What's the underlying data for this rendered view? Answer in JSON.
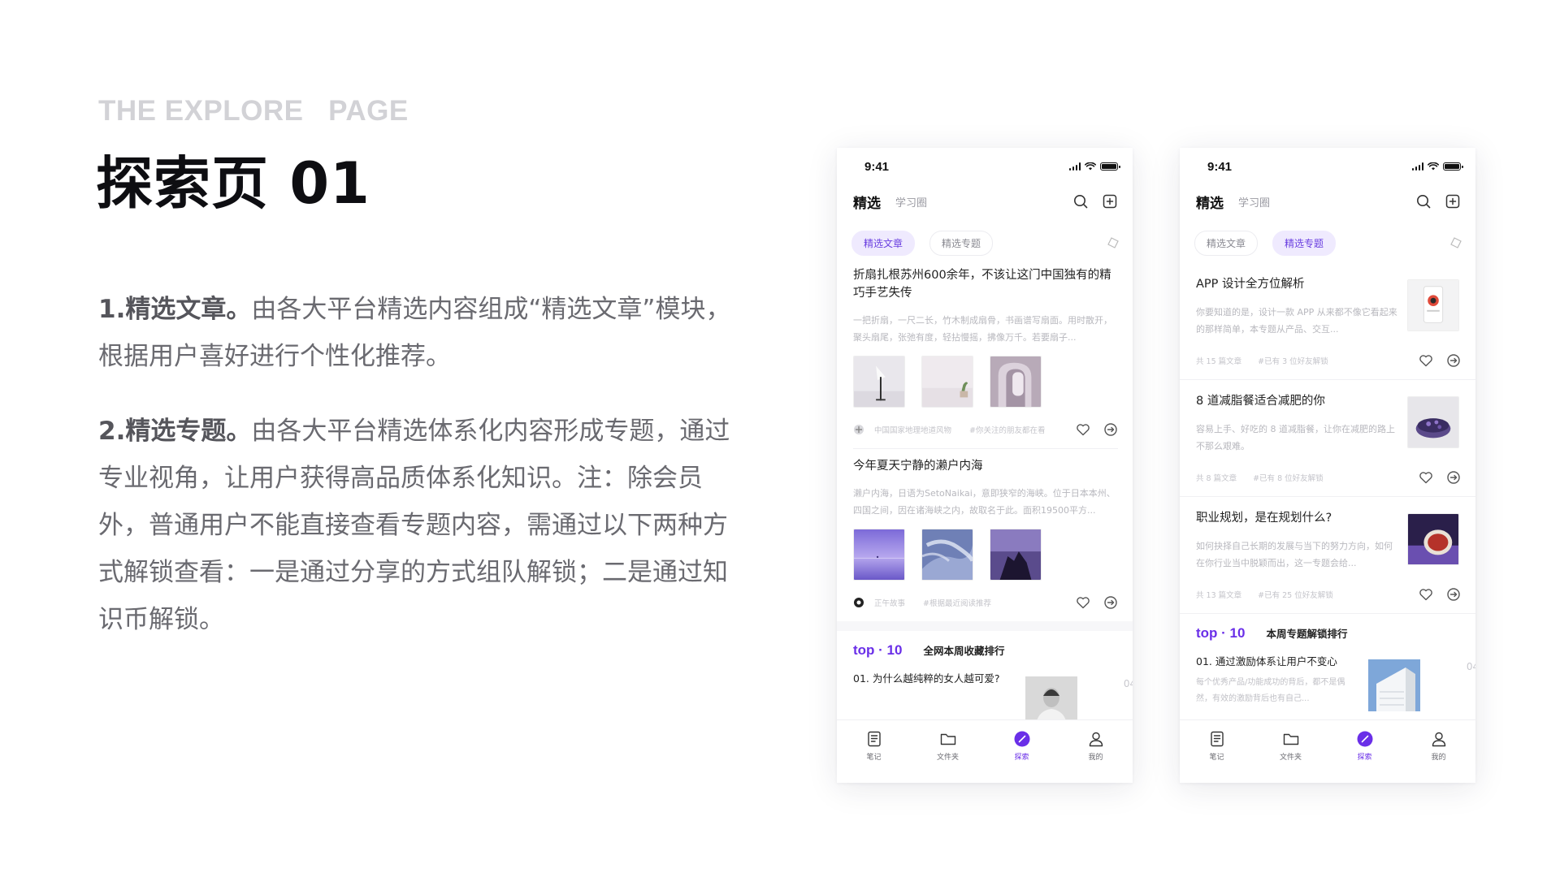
{
  "header": {
    "eyebrow": "THE EXPLORE   PAGE",
    "title": "探索页 01"
  },
  "description": {
    "p1_strong": "1.精选文章。",
    "p1_text": "由各大平台精选内容组成“精选文章”模块，根据用户喜好进行个性化推荐。",
    "p2_strong": "2.精选专题。",
    "p2_text": "由各大平台精选体系化内容形成专题，通过专业视角，让用户获得高品质体系化知识。注：除会员外，普通用户不能直接查看专题内容，需通过以下两种方式解锁查看：一是通过分享的方式组队解锁；二是通过知识币解锁。"
  },
  "colors": {
    "accent": "#6a2fe8",
    "chip_bg": "#efeafe"
  },
  "phoneA": {
    "time": "9:41",
    "tab_main": "精选",
    "tab_sub": "学习圈",
    "chip1": "精选文章",
    "chip2": "精选专题",
    "active_chip": "精选文章",
    "articles": [
      {
        "title": "折扇扎根苏州600余年，不该让这门中国独有的精巧手艺失传",
        "desc": "一把折扇，一尺二长，竹木制成扇骨，书画谱写扇面。用时散开，聚头扇尾，张弛有度，轻拈慢摇，拂像万千。若要扇子...",
        "source": "中国国家地理地道风物",
        "tag": "#你关注的朋友都在看"
      },
      {
        "title": "今年夏天宁静的濑户内海",
        "desc": "濑户内海，日语为SetoNaikai，意即狭窄的海峡。位于日本本州、四国之间，因在诸海峡之内，故取名于此。面积19500平方...",
        "source": "正午故事",
        "tag": "#根据最近阅读推荐"
      }
    ],
    "top10": {
      "word": "top · 10",
      "sub": "全网本周收藏排行",
      "item": "01. 为什么越纯粹的女人越可爱?",
      "next": "04."
    }
  },
  "phoneB": {
    "time": "9:41",
    "tab_main": "精选",
    "tab_sub": "学习圈",
    "chip1": "精选文章",
    "chip2": "精选专题",
    "active_chip": "精选专题",
    "topics": [
      {
        "title": "APP 设计全方位解析",
        "desc": "你要知道的是，设计一款 APP 从来都不像它看起来的那样简单，本专题从产品、交互...",
        "count": "共 15 篇文章",
        "unlock": "#已有 3 位好友解锁"
      },
      {
        "title": "8 道减脂餐适合减肥的你",
        "desc": "容易上手、好吃的 8 道减脂餐，让你在减肥的路上不那么艰难。",
        "count": "共 8 篇文章",
        "unlock": "#已有 8 位好友解锁"
      },
      {
        "title": "职业规划，是在规划什么?",
        "desc": "如何抉择自己长期的发展与当下的努力方向，如何在你行业当中脱颖而出，这一专题会给...",
        "count": "共 13 篇文章",
        "unlock": "#已有 25 位好友解锁"
      }
    ],
    "top10": {
      "word": "top · 10",
      "sub": "本周专题解锁排行",
      "item": "01. 通过激励体系让用户不变心",
      "desc": "每个优秀产品/功能成功的背后，都不是偶然，有效的激励背后也有自己...",
      "next": "04."
    }
  },
  "tabbar": {
    "items": [
      "笔记",
      "文件夹",
      "探索",
      "我的"
    ],
    "active": "探索"
  }
}
